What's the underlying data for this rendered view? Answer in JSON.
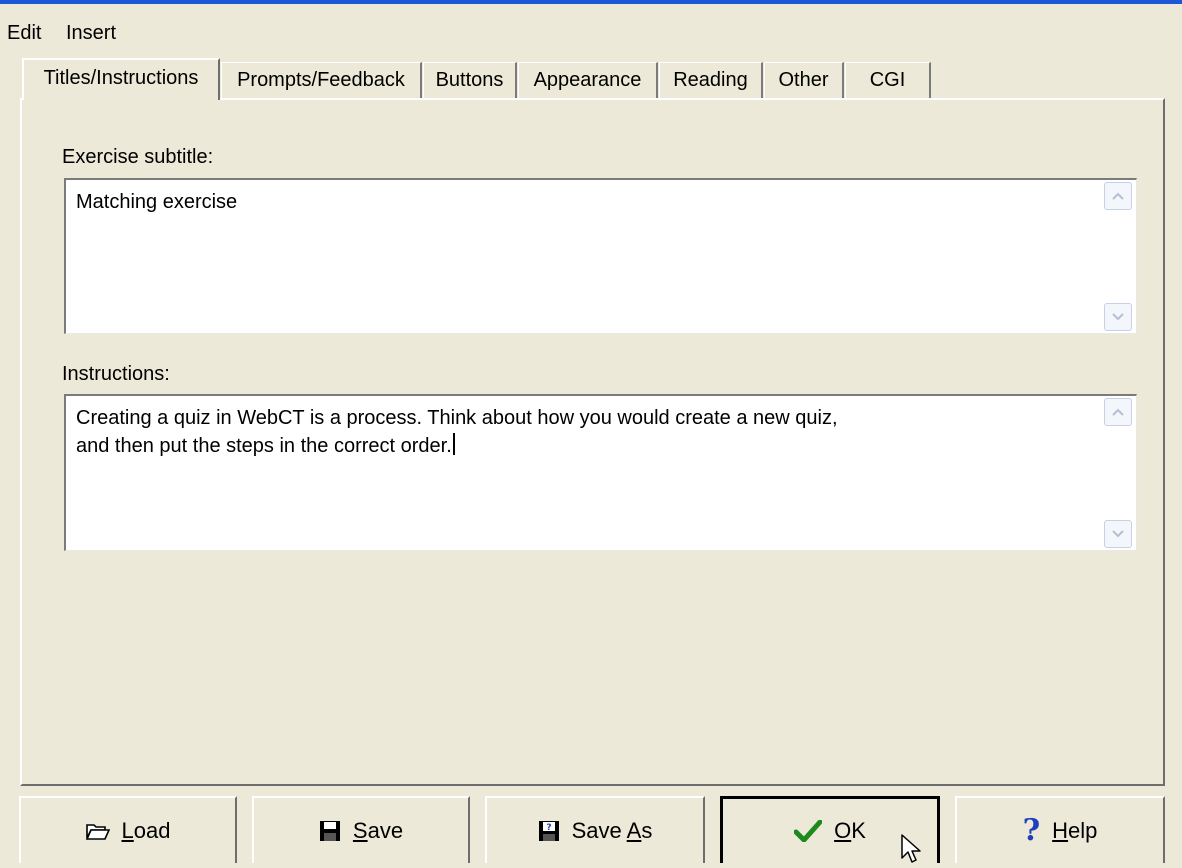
{
  "menu": {
    "edit": "Edit",
    "insert": "Insert"
  },
  "tabs": [
    {
      "label": "Titles/Instructions",
      "active": true
    },
    {
      "label": "Prompts/Feedback"
    },
    {
      "label": "Buttons"
    },
    {
      "label": "Appearance"
    },
    {
      "label": "Reading"
    },
    {
      "label": "Other"
    },
    {
      "label": "CGI"
    }
  ],
  "subtitle": {
    "label": "Exercise subtitle:",
    "value": "Matching exercise"
  },
  "instructions": {
    "label": "Instructions:",
    "line1": "Creating a quiz in WebCT is a process. Think about how you would create a new quiz,",
    "line2": "and then put the steps in the correct order."
  },
  "buttons": {
    "load": {
      "mnemonic": "L",
      "rest": "oad",
      "icon": "folder-open-icon"
    },
    "save": {
      "mnemonic": "S",
      "rest": "ave",
      "icon": "floppy-disk-icon"
    },
    "save_as": {
      "prefix": "Save ",
      "mnemonic": "A",
      "rest": "s",
      "icon": "floppy-disk-question-icon"
    },
    "ok": {
      "mnemonic": "O",
      "rest": "K",
      "icon": "checkmark-icon"
    },
    "help": {
      "mnemonic": "H",
      "rest": "elp",
      "icon": "question-mark-icon"
    }
  },
  "colors": {
    "face": "#ece9d8",
    "title_accent": "#1c58d6",
    "ok_check": "#1e8a1e",
    "help_question": "#1f3fbf"
  }
}
